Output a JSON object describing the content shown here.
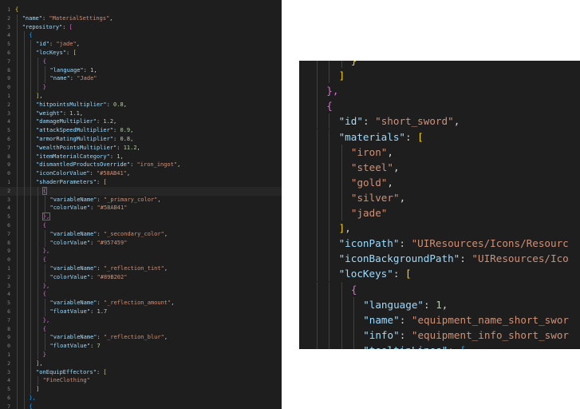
{
  "left_editor": {
    "line_numbers": [
      "1",
      "2",
      "3",
      "4",
      "5",
      "6",
      "7",
      "8",
      "9",
      "0",
      "1",
      "2",
      "3",
      "4",
      "5",
      "6",
      "7",
      "8",
      "9",
      "0",
      "1",
      "2",
      "3",
      "4",
      "5",
      "6",
      "7",
      "8",
      "9",
      "0",
      "1",
      "2",
      "3",
      "4",
      "5",
      "6",
      "7",
      "8",
      "9",
      "0",
      "1",
      "2",
      "3",
      "4",
      "5",
      "6",
      "7"
    ],
    "active_line": 21,
    "lines": [
      {
        "indent": 0,
        "tokens": [
          [
            "{",
            "b1"
          ]
        ]
      },
      {
        "indent": 1,
        "tokens": [
          [
            "\"name\"",
            "k"
          ],
          [
            ": ",
            "p"
          ],
          [
            "\"MaterialSettings\"",
            "s"
          ],
          [
            ",",
            "p"
          ]
        ]
      },
      {
        "indent": 1,
        "tokens": [
          [
            "\"repository\"",
            "k"
          ],
          [
            ": ",
            "p"
          ],
          [
            "[",
            "b2"
          ]
        ]
      },
      {
        "indent": 2,
        "tokens": [
          [
            "{",
            "b3"
          ]
        ]
      },
      {
        "indent": 3,
        "tokens": [
          [
            "\"id\"",
            "k"
          ],
          [
            ": ",
            "p"
          ],
          [
            "\"jade\"",
            "s"
          ],
          [
            ",",
            "p"
          ]
        ]
      },
      {
        "indent": 3,
        "tokens": [
          [
            "\"locKeys\"",
            "k"
          ],
          [
            ": ",
            "p"
          ],
          [
            "[",
            "b1"
          ]
        ]
      },
      {
        "indent": 4,
        "tokens": [
          [
            "{",
            "b2"
          ]
        ]
      },
      {
        "indent": 5,
        "tokens": [
          [
            "\"language\"",
            "k"
          ],
          [
            ": ",
            "p"
          ],
          [
            "1",
            "n"
          ],
          [
            ",",
            "p"
          ]
        ]
      },
      {
        "indent": 5,
        "tokens": [
          [
            "\"name\"",
            "k"
          ],
          [
            ": ",
            "p"
          ],
          [
            "\"Jade\"",
            "s"
          ]
        ]
      },
      {
        "indent": 4,
        "tokens": [
          [
            "}",
            "b2"
          ]
        ]
      },
      {
        "indent": 3,
        "tokens": [
          [
            "]",
            "b1"
          ],
          [
            ",",
            "p"
          ]
        ]
      },
      {
        "indent": 3,
        "tokens": [
          [
            "\"hitpointsMultiplier\"",
            "k"
          ],
          [
            ": ",
            "p"
          ],
          [
            "0.8",
            "n"
          ],
          [
            ",",
            "p"
          ]
        ]
      },
      {
        "indent": 3,
        "tokens": [
          [
            "\"weight\"",
            "k"
          ],
          [
            ": ",
            "p"
          ],
          [
            "1.1",
            "n"
          ],
          [
            ",",
            "p"
          ]
        ]
      },
      {
        "indent": 3,
        "tokens": [
          [
            "\"damageMultiplier\"",
            "k"
          ],
          [
            ": ",
            "p"
          ],
          [
            "1.2",
            "n"
          ],
          [
            ",",
            "p"
          ]
        ]
      },
      {
        "indent": 3,
        "tokens": [
          [
            "\"attackSpeedMultiplier\"",
            "k"
          ],
          [
            ": ",
            "p"
          ],
          [
            "0.9",
            "n"
          ],
          [
            ",",
            "p"
          ]
        ]
      },
      {
        "indent": 3,
        "tokens": [
          [
            "\"armorRatingMultiplier\"",
            "k"
          ],
          [
            ": ",
            "p"
          ],
          [
            "0.8",
            "n"
          ],
          [
            ",",
            "p"
          ]
        ]
      },
      {
        "indent": 3,
        "tokens": [
          [
            "\"wealthPointsMultiplier\"",
            "k"
          ],
          [
            ": ",
            "p"
          ],
          [
            "11.2",
            "n"
          ],
          [
            ",",
            "p"
          ]
        ]
      },
      {
        "indent": 3,
        "tokens": [
          [
            "\"itemMaterialCategory\"",
            "k"
          ],
          [
            ": ",
            "p"
          ],
          [
            "1",
            "n"
          ],
          [
            ",",
            "p"
          ]
        ]
      },
      {
        "indent": 3,
        "tokens": [
          [
            "\"dismantledProductsOverride\"",
            "k"
          ],
          [
            ": ",
            "p"
          ],
          [
            "\"iron_ingot\"",
            "s"
          ],
          [
            ",",
            "p"
          ]
        ]
      },
      {
        "indent": 3,
        "tokens": [
          [
            "\"iconColorValue\"",
            "k"
          ],
          [
            ": ",
            "p"
          ],
          [
            "\"#58AB41\"",
            "s"
          ],
          [
            ",",
            "p"
          ]
        ]
      },
      {
        "indent": 3,
        "tokens": [
          [
            "\"shaderParameters\"",
            "k"
          ],
          [
            ": ",
            "p"
          ],
          [
            "[",
            "b1"
          ]
        ]
      },
      {
        "indent": 4,
        "tokens": [
          [
            "{",
            "b2"
          ]
        ]
      },
      {
        "indent": 5,
        "tokens": [
          [
            "\"variableName\"",
            "k"
          ],
          [
            ": ",
            "p"
          ],
          [
            "\"_primary_color\"",
            "s"
          ],
          [
            ",",
            "p"
          ]
        ]
      },
      {
        "indent": 5,
        "tokens": [
          [
            "\"colorValue\"",
            "k"
          ],
          [
            ": ",
            "p"
          ],
          [
            "\"#58AB41\"",
            "s"
          ]
        ]
      },
      {
        "indent": 4,
        "tokens": [
          [
            "},",
            "b2"
          ]
        ]
      },
      {
        "indent": 4,
        "tokens": [
          [
            "{",
            "b2"
          ]
        ]
      },
      {
        "indent": 5,
        "tokens": [
          [
            "\"variableName\"",
            "k"
          ],
          [
            ": ",
            "p"
          ],
          [
            "\"_secondary_color\"",
            "s"
          ],
          [
            ",",
            "p"
          ]
        ]
      },
      {
        "indent": 5,
        "tokens": [
          [
            "\"colorValue\"",
            "k"
          ],
          [
            ": ",
            "p"
          ],
          [
            "\"#957459\"",
            "s"
          ]
        ]
      },
      {
        "indent": 4,
        "tokens": [
          [
            "},",
            "b2"
          ]
        ]
      },
      {
        "indent": 4,
        "tokens": [
          [
            "{",
            "b2"
          ]
        ]
      },
      {
        "indent": 5,
        "tokens": [
          [
            "\"variableName\"",
            "k"
          ],
          [
            ": ",
            "p"
          ],
          [
            "\"_reflection_tint\"",
            "s"
          ],
          [
            ",",
            "p"
          ]
        ]
      },
      {
        "indent": 5,
        "tokens": [
          [
            "\"colorValue\"",
            "k"
          ],
          [
            ": ",
            "p"
          ],
          [
            "\"#89B202\"",
            "s"
          ]
        ]
      },
      {
        "indent": 4,
        "tokens": [
          [
            "},",
            "b2"
          ]
        ]
      },
      {
        "indent": 4,
        "tokens": [
          [
            "{",
            "b2"
          ]
        ]
      },
      {
        "indent": 5,
        "tokens": [
          [
            "\"variableName\"",
            "k"
          ],
          [
            ": ",
            "p"
          ],
          [
            "\"_reflection_amount\"",
            "s"
          ],
          [
            ",",
            "p"
          ]
        ]
      },
      {
        "indent": 5,
        "tokens": [
          [
            "\"floatValue\"",
            "k"
          ],
          [
            ": ",
            "p"
          ],
          [
            "1.7",
            "n"
          ]
        ]
      },
      {
        "indent": 4,
        "tokens": [
          [
            "},",
            "b2"
          ]
        ]
      },
      {
        "indent": 4,
        "tokens": [
          [
            "{",
            "b2"
          ]
        ]
      },
      {
        "indent": 5,
        "tokens": [
          [
            "\"variableName\"",
            "k"
          ],
          [
            ": ",
            "p"
          ],
          [
            "\"_reflection_blur\"",
            "s"
          ],
          [
            ",",
            "p"
          ]
        ]
      },
      {
        "indent": 5,
        "tokens": [
          [
            "\"floatValue\"",
            "k"
          ],
          [
            ": ",
            "p"
          ],
          [
            "7",
            "n"
          ]
        ]
      },
      {
        "indent": 4,
        "tokens": [
          [
            "}",
            "b2"
          ]
        ]
      },
      {
        "indent": 3,
        "tokens": [
          [
            "]",
            "b1"
          ],
          [
            ",",
            "p"
          ]
        ]
      },
      {
        "indent": 3,
        "tokens": [
          [
            "\"onEquipEffectors\"",
            "k"
          ],
          [
            ": ",
            "p"
          ],
          [
            "[",
            "b1"
          ]
        ]
      },
      {
        "indent": 4,
        "tokens": [
          [
            "\"FineClothing\"",
            "s"
          ]
        ]
      },
      {
        "indent": 3,
        "tokens": [
          [
            "]",
            "b1"
          ]
        ]
      },
      {
        "indent": 2,
        "tokens": [
          [
            "},",
            "b3"
          ]
        ]
      },
      {
        "indent": 2,
        "tokens": [
          [
            "{",
            "b3"
          ]
        ]
      }
    ]
  },
  "right_editor": {
    "lines": [
      {
        "indent": 3,
        "tokens": [
          [
            "}",
            "b1"
          ]
        ]
      },
      {
        "indent": 2,
        "tokens": [
          [
            "]",
            "b1"
          ]
        ]
      },
      {
        "indent": 1,
        "tokens": [
          [
            "},",
            "b2"
          ]
        ]
      },
      {
        "indent": 1,
        "tokens": [
          [
            "{",
            "b2"
          ]
        ]
      },
      {
        "indent": 2,
        "tokens": [
          [
            "\"id\"",
            "k"
          ],
          [
            ": ",
            "p"
          ],
          [
            "\"short_sword\"",
            "s"
          ],
          [
            ",",
            "p"
          ]
        ]
      },
      {
        "indent": 2,
        "tokens": [
          [
            "\"materials\"",
            "k"
          ],
          [
            ": ",
            "p"
          ],
          [
            "[",
            "b1"
          ]
        ]
      },
      {
        "indent": 3,
        "tokens": [
          [
            "\"iron\"",
            "s"
          ],
          [
            ",",
            "p"
          ]
        ]
      },
      {
        "indent": 3,
        "tokens": [
          [
            "\"steel\"",
            "s"
          ],
          [
            ",",
            "p"
          ]
        ]
      },
      {
        "indent": 3,
        "tokens": [
          [
            "\"gold\"",
            "s"
          ],
          [
            ",",
            "p"
          ]
        ]
      },
      {
        "indent": 3,
        "tokens": [
          [
            "\"silver\"",
            "s"
          ],
          [
            ",",
            "p"
          ]
        ]
      },
      {
        "indent": 3,
        "tokens": [
          [
            "\"jade\"",
            "s"
          ]
        ]
      },
      {
        "indent": 2,
        "tokens": [
          [
            "]",
            "b1"
          ],
          [
            ",",
            "p"
          ]
        ]
      },
      {
        "indent": 2,
        "tokens": [
          [
            "\"iconPath\"",
            "k"
          ],
          [
            ": ",
            "p"
          ],
          [
            "\"UIResources/Icons/Resourc",
            "s"
          ]
        ]
      },
      {
        "indent": 2,
        "tokens": [
          [
            "\"iconBackgroundPath\"",
            "k"
          ],
          [
            ": ",
            "p"
          ],
          [
            "\"UIResources/Ico",
            "s"
          ]
        ]
      },
      {
        "indent": 2,
        "tokens": [
          [
            "\"locKeys\"",
            "k"
          ],
          [
            ": ",
            "p"
          ],
          [
            "[",
            "b1"
          ]
        ]
      },
      {
        "indent": 3,
        "tokens": [
          [
            "{",
            "b2"
          ]
        ]
      },
      {
        "indent": 4,
        "tokens": [
          [
            "\"language\"",
            "k"
          ],
          [
            ": ",
            "p"
          ],
          [
            "1",
            "n"
          ],
          [
            ",",
            "p"
          ]
        ]
      },
      {
        "indent": 4,
        "tokens": [
          [
            "\"name\"",
            "k"
          ],
          [
            ": ",
            "p"
          ],
          [
            "\"equipment_name_short_swor",
            "s"
          ]
        ]
      },
      {
        "indent": 4,
        "tokens": [
          [
            "\"info\"",
            "k"
          ],
          [
            ": ",
            "p"
          ],
          [
            "\"equipment_info_short_swor",
            "s"
          ]
        ]
      },
      {
        "indent": 4,
        "tokens": [
          [
            "\"tooltipLines\"",
            "k"
          ],
          [
            ": ",
            "p"
          ],
          [
            "[",
            "b3"
          ]
        ]
      }
    ]
  },
  "colors": {
    "editor_background": "#1e1e1e",
    "page_background": "#ffffff",
    "key": "#9cdcfe",
    "string": "#ce9178",
    "number": "#b5cea8",
    "punctuation": "#d4d4d4",
    "bracket_level_1": "#ffd700",
    "bracket_level_2": "#da70d6",
    "bracket_level_3": "#179fff",
    "line_number": "#858585"
  }
}
